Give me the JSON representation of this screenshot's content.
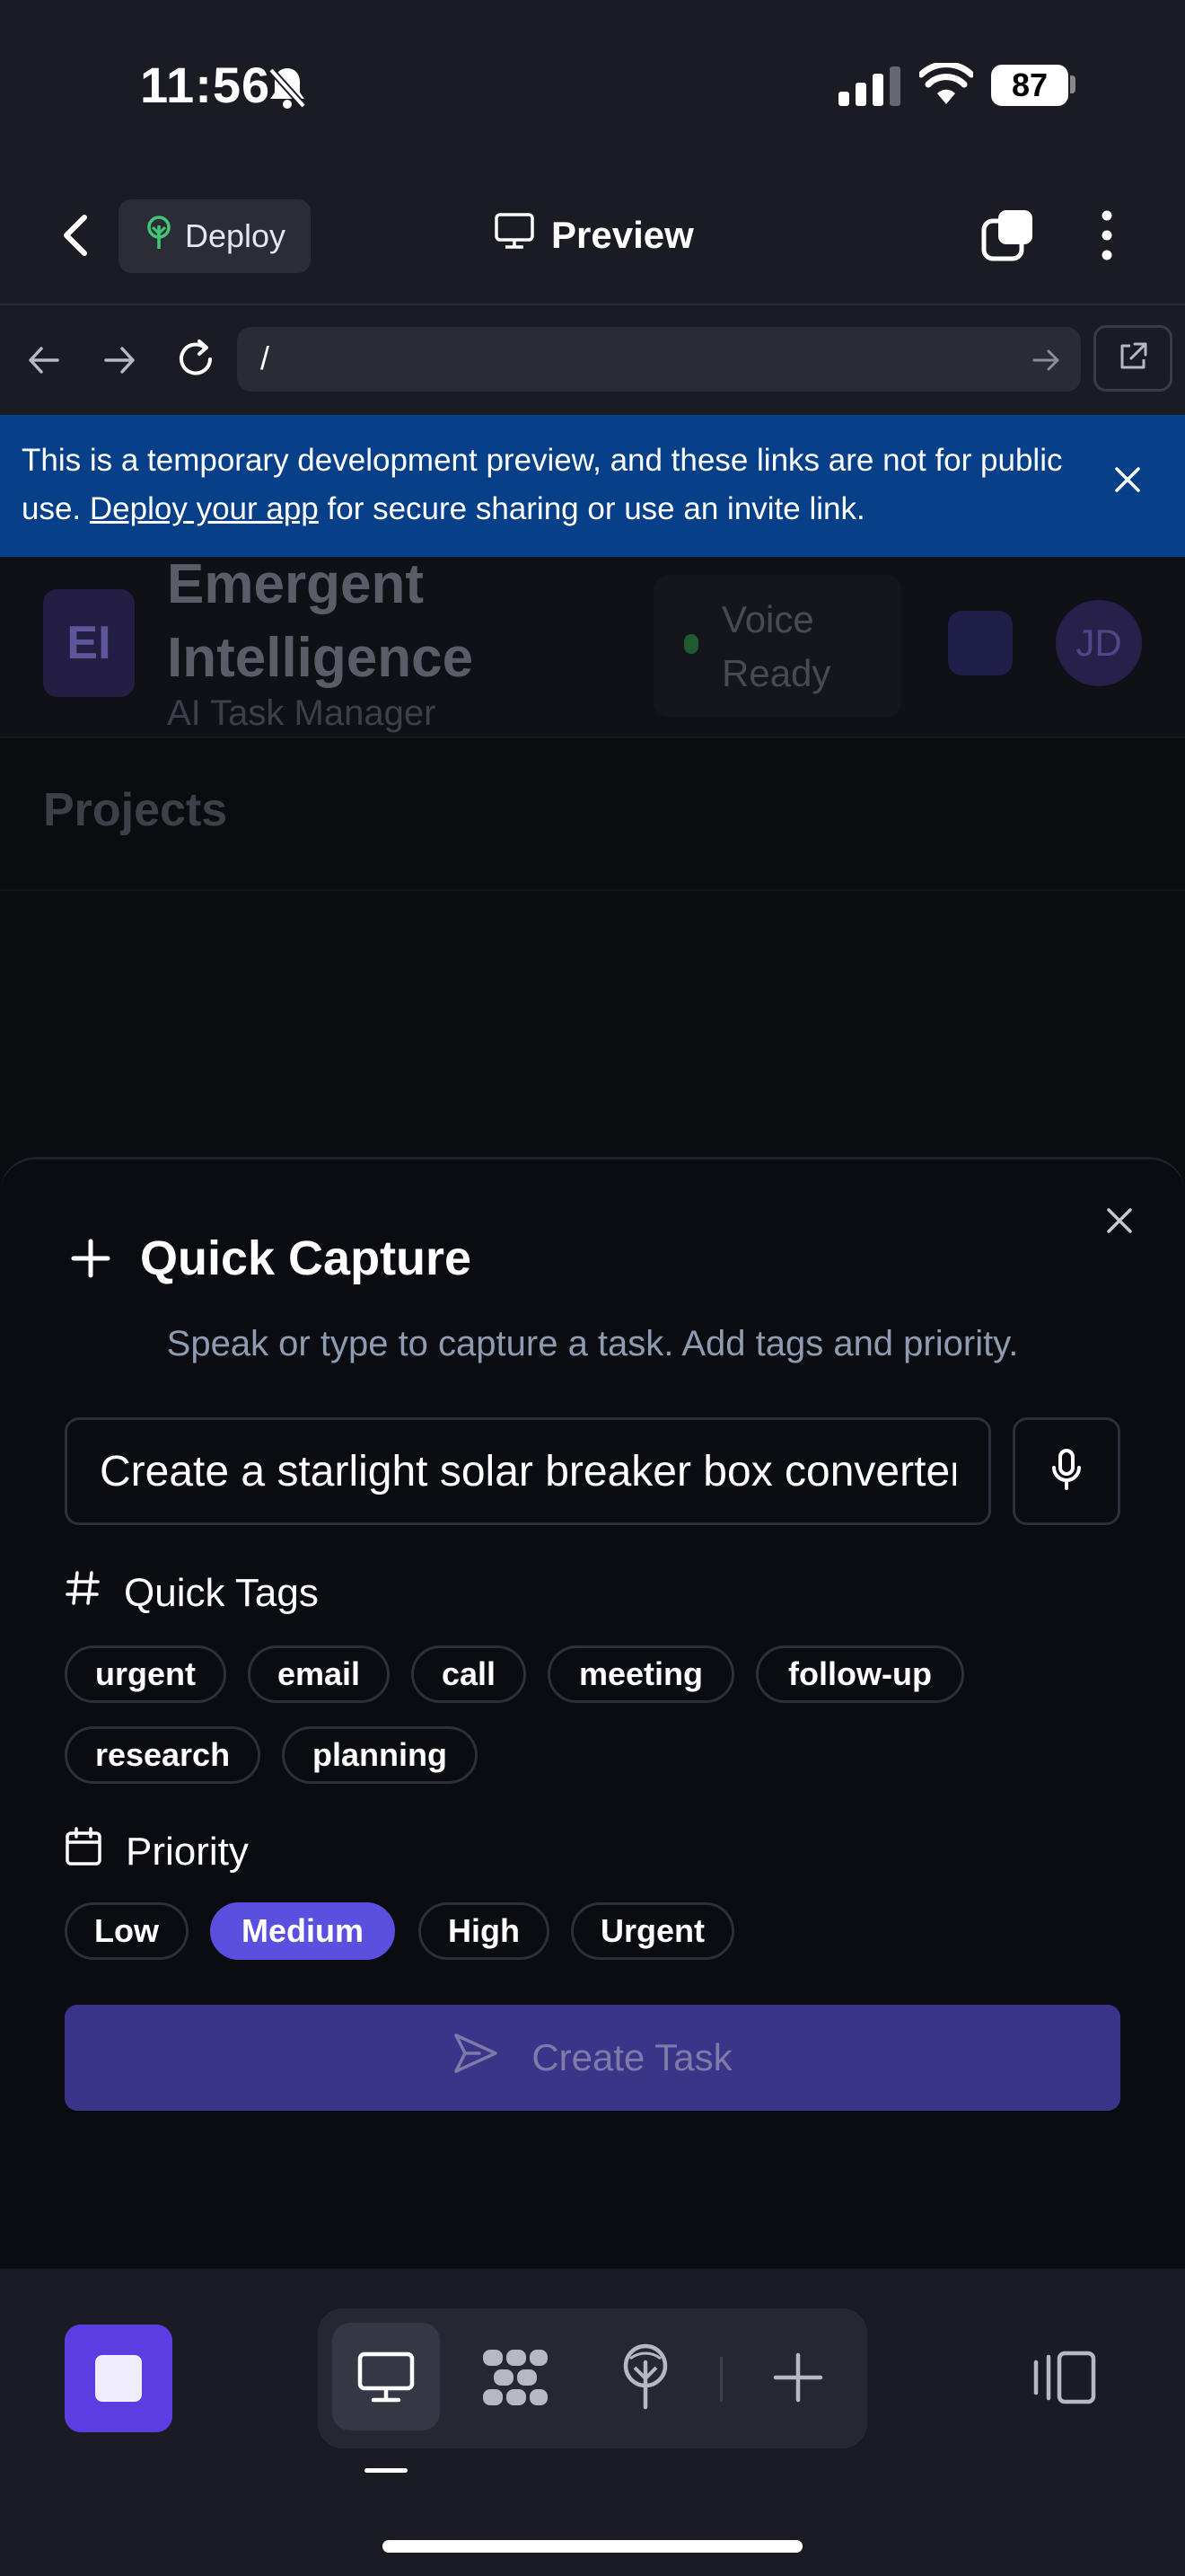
{
  "status_bar": {
    "time": "11:56",
    "battery": "87"
  },
  "browser_bar": {
    "deploy_label": "Deploy",
    "preview_label": "Preview"
  },
  "url_bar": {
    "url": "/"
  },
  "banner": {
    "text_before": "This is a temporary development preview, and these links are not for public use. ",
    "link_text": "Deploy your app",
    "text_after": " for secure sharing or use an invite link."
  },
  "background_app": {
    "logo_initials": "EI",
    "brand_line1": "Emergent",
    "brand_line2": "Intelligence",
    "brand_subtitle": "AI Task Manager",
    "voice_line1": "Voice",
    "voice_line2": "Ready",
    "avatar_initials": "JD",
    "section_title": "Projects"
  },
  "quick_capture": {
    "title": "Quick Capture",
    "subtitle": "Speak or type to capture a task. Add tags and priority.",
    "input_value": "Create a starlight solar breaker box converter",
    "tags_label": "Quick Tags",
    "tags": [
      "urgent",
      "email",
      "call",
      "meeting",
      "follow-up",
      "research",
      "planning"
    ],
    "priority_label": "Priority",
    "priorities": [
      "Low",
      "Medium",
      "High",
      "Urgent"
    ],
    "selected_priority": "Medium",
    "create_label": "Create Task"
  },
  "colors": {
    "accent": "#5b4fe0",
    "banner": "#074088",
    "create_button": "#3b3589"
  }
}
